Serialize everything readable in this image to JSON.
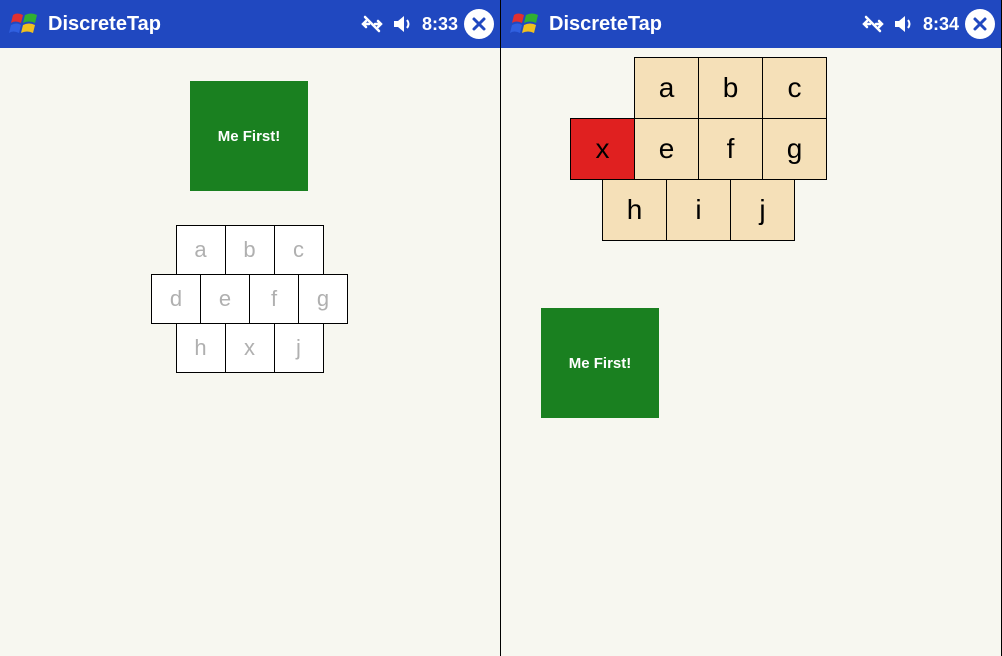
{
  "left": {
    "titlebar": {
      "title": "DiscreteTap",
      "time": "8:33"
    },
    "greenButton": {
      "label": "Me First!"
    },
    "grid": {
      "rows": [
        {
          "cells": [
            "a",
            "b",
            "c"
          ]
        },
        {
          "cells": [
            "d",
            "e",
            "f",
            "g"
          ]
        },
        {
          "cells": [
            "h",
            "x",
            "j"
          ]
        }
      ]
    }
  },
  "right": {
    "titlebar": {
      "title": "DiscreteTap",
      "time": "8:34"
    },
    "greenButton": {
      "label": "Me First!"
    },
    "grid": {
      "rows": [
        {
          "cells": [
            "a",
            "b",
            "c"
          ]
        },
        {
          "cells": [
            "x",
            "e",
            "f",
            "g"
          ],
          "highlight": 0
        },
        {
          "cells": [
            "h",
            "i",
            "j"
          ]
        }
      ]
    }
  }
}
